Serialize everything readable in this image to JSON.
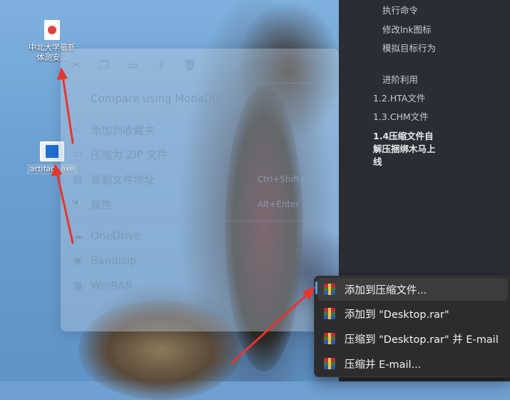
{
  "desktop": {
    "icons": [
      {
        "label": "中北大学最新体测安...",
        "kind": "pdf-file-icon"
      },
      {
        "label": "artifact.exe",
        "kind": "exe-file-icon"
      }
    ]
  },
  "context_menu": {
    "toolbar": [
      "cut-icon",
      "copy-icon",
      "rename-icon",
      "share-icon",
      "delete-icon"
    ],
    "items": [
      {
        "label": "Compare using MobaDiff",
        "icon": "compare-icon",
        "accelerator": ""
      },
      {
        "label": "添加到收藏夹",
        "icon": "star-icon",
        "accelerator": ""
      },
      {
        "label": "压缩为 ZIP 文件",
        "icon": "zip-folder-icon",
        "accelerator": ""
      },
      {
        "label": "复制文件地址",
        "icon": "copy-path-icon",
        "accelerator": "Ctrl+Shift+C"
      },
      {
        "label": "属性",
        "icon": "wrench-icon",
        "accelerator": "Alt+Enter"
      },
      {
        "label": "OneDrive",
        "icon": "onedrive-icon",
        "accelerator": ""
      },
      {
        "label": "Bandizip",
        "icon": "bandizip-icon",
        "accelerator": ""
      },
      {
        "label": "WinRAR",
        "icon": "winrar-icon",
        "accelerator": ""
      }
    ]
  },
  "doc_toc": {
    "items": [
      {
        "label": "执行命令"
      },
      {
        "label": "修改lnk图标"
      },
      {
        "label": "模拟目标行为"
      },
      {
        "label": "进阶利用"
      },
      {
        "label": "1.2.HTA文件"
      },
      {
        "label": "1.3.CHM文件"
      },
      {
        "label": "1.4压缩文件自解压捆绑木马上线"
      }
    ]
  },
  "winrar_submenu": {
    "items": [
      {
        "label": "添加到压缩文件..."
      },
      {
        "label": "添加到 \"Desktop.rar\""
      },
      {
        "label": "压缩到 \"Desktop.rar\" 并 E-mail"
      },
      {
        "label": "压缩并 E-mail..."
      }
    ]
  },
  "colors": {
    "annotation_arrow": "#e8352e",
    "submenu_bg": "#2c2c2c",
    "doc_panel_bg": "#2a2d33"
  }
}
